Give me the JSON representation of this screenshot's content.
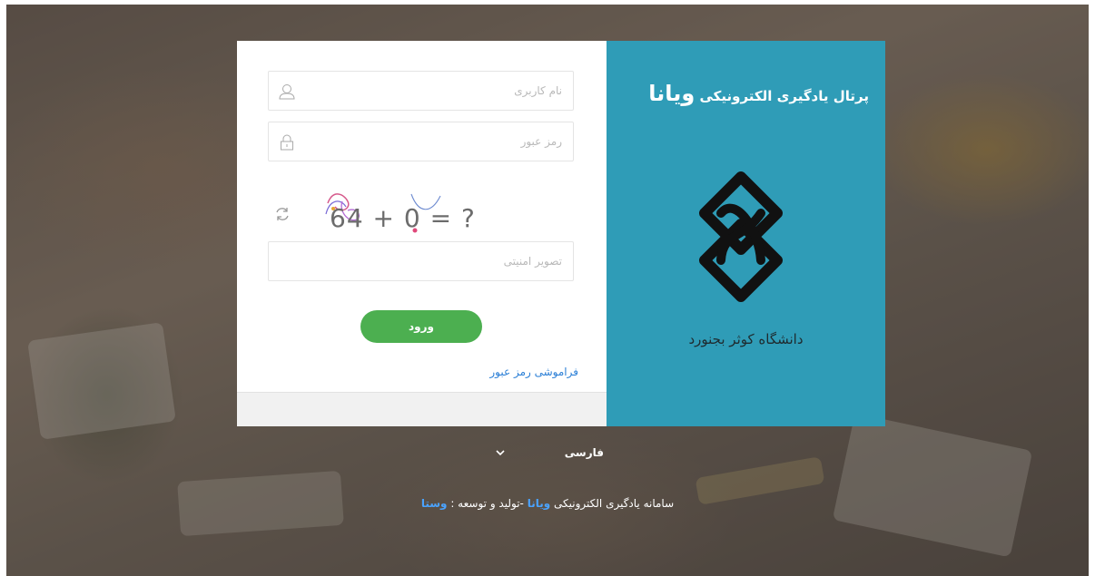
{
  "login": {
    "username_placeholder": "نام کاربری",
    "password_placeholder": "رمز عبور",
    "captcha_text": "64 + 0 = ?",
    "security_placeholder": "تصویر امنیتی",
    "login_label": "ورود",
    "forgot_label": "فراموشی رمز عبور"
  },
  "branding": {
    "portal_prefix": "پرتال یادگیری الکترونیکی",
    "portal_brand": "ویانا",
    "university_name": "دانشگاه کوثر بجنورد",
    "accent_color": "#2f9cb7",
    "button_color": "#4caf50"
  },
  "language": {
    "selected": "فارسی"
  },
  "footer": {
    "text_before": "سامانه یادگیری الکترونیکی",
    "brand": "ویانا",
    "text_middle": "-تولید و توسعه :",
    "developer": "وستا"
  },
  "icons": [
    "user-icon",
    "lock-icon",
    "refresh-icon",
    "chevron-down-icon",
    "university-logo"
  ]
}
